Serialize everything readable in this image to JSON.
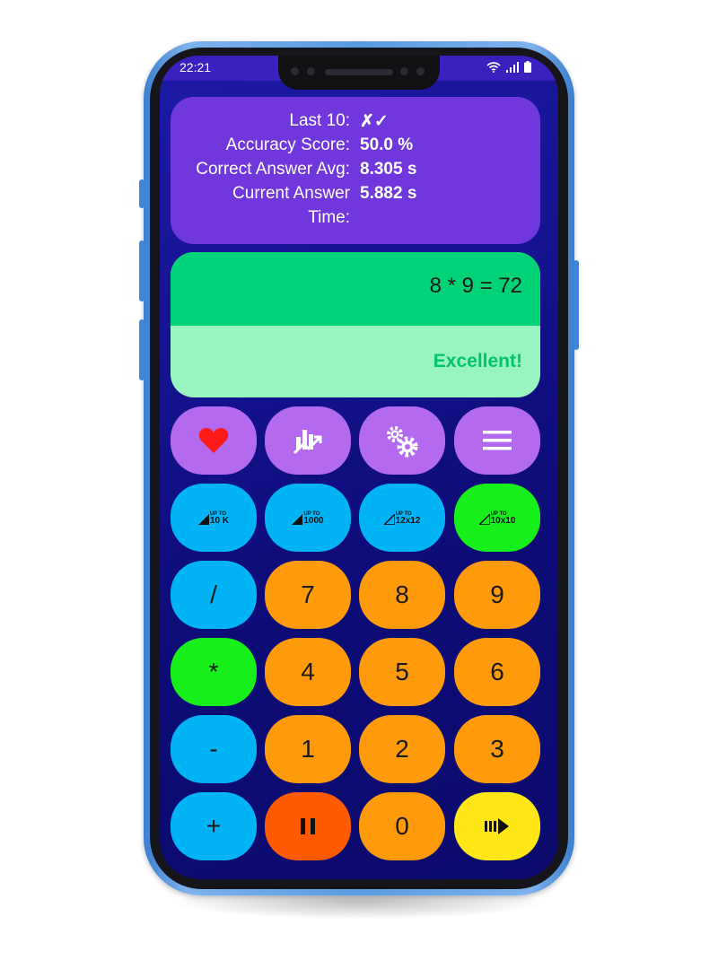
{
  "status_bar": {
    "time": "22:21"
  },
  "stats": {
    "rows": [
      {
        "label": "Last 10:",
        "value": "✗✓"
      },
      {
        "label": "Accuracy Score:",
        "value": "50.0 %"
      },
      {
        "label": "Correct Answer Avg:",
        "value": "8.305 s"
      },
      {
        "label": "Current Answer",
        "value": "5.882 s"
      },
      {
        "label": "Time:",
        "value": ""
      }
    ]
  },
  "display": {
    "equation": "8 * 9 = 72",
    "feedback": "Excellent!"
  },
  "toolbar": {
    "icons": [
      "heart-icon",
      "chart-icon",
      "gears-icon",
      "menu-icon"
    ]
  },
  "levels": [
    {
      "up": "UP TO",
      "value": "10 K"
    },
    {
      "up": "UP TO",
      "value": "1000"
    },
    {
      "up": "UP TO",
      "value": "12x12"
    },
    {
      "up": "UP TO",
      "value": "10x10"
    }
  ],
  "keypad": {
    "divide": "/",
    "multiply": "*",
    "subtract": "-",
    "add": "+",
    "seven": "7",
    "eight": "8",
    "nine": "9",
    "four": "4",
    "five": "5",
    "six": "6",
    "one": "1",
    "two": "2",
    "three": "3",
    "zero": "0"
  },
  "colors": {
    "screen_bg": "#14128c",
    "stats_bg": "#6f37dc",
    "display_top": "#00d278",
    "display_bottom": "#99f5c0",
    "feedback": "#00c46a",
    "purple": "#b46af0",
    "blue": "#00b3f5",
    "green": "#17ef1a",
    "orange": "#ff9a0a",
    "pause": "#ff5a00",
    "next": "#ffe617",
    "heart": "#ff1a1a"
  }
}
